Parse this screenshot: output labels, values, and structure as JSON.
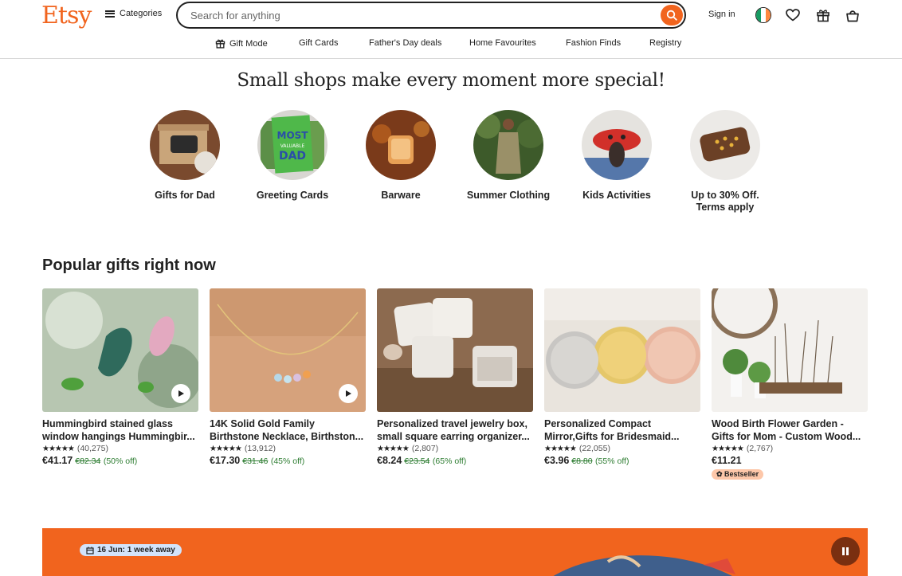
{
  "header": {
    "logo": "Etsy",
    "categories_label": "Categories",
    "search_placeholder": "Search for anything",
    "sign_in": "Sign in"
  },
  "nav": {
    "items": [
      "Gift Mode",
      "Gift Cards",
      "Father's Day deals",
      "Home Favourites",
      "Fashion Finds",
      "Registry"
    ]
  },
  "headline": "Small shops make every moment more special!",
  "circles": [
    {
      "label": "Gifts for Dad"
    },
    {
      "label": "Greeting Cards"
    },
    {
      "label": "Barware"
    },
    {
      "label": "Summer Clothing"
    },
    {
      "label": "Kids Activities"
    },
    {
      "label": "Up to 30% Off. Terms apply"
    }
  ],
  "greeting_card_text": {
    "line1": "MOST",
    "line2": "VALUABLE",
    "line3": "DAD"
  },
  "popular": {
    "title": "Popular gifts right now",
    "items": [
      {
        "title1": "Hummingbird stained glass",
        "title2": "window hangings Hummingbir...",
        "reviews": "(40,275)",
        "price": "€41.17",
        "old_price": "€82.34",
        "discount": "(50% off)"
      },
      {
        "title1": "14K Solid Gold Family",
        "title2": "Birthstone Necklace, Birthston...",
        "reviews": "(13,912)",
        "price": "€17.30",
        "old_price": "€31.46",
        "discount": "(45% off)"
      },
      {
        "title1": "Personalized travel jewelry box,",
        "title2": "small square earring organizer...",
        "reviews": "(2,807)",
        "price": "€8.24",
        "old_price": "€23.54",
        "discount": "(65% off)"
      },
      {
        "title1": "Personalized Compact",
        "title2": "Mirror,Gifts for Bridesmaid...",
        "reviews": "(22,055)",
        "price": "€3.96",
        "old_price": "€8.80",
        "discount": "(55% off)"
      },
      {
        "title1": "Wood Birth Flower Garden -",
        "title2": "Gifts for Mom - Custom Wood...",
        "reviews": "(2,767)",
        "price": "€11.21",
        "badge": "Bestseller"
      }
    ]
  },
  "banner": {
    "date_pill": "16 Jun: 1 week away"
  },
  "colors": {
    "brand": "#f1641e",
    "sale_green": "#2e7d32",
    "badge_bg": "#fdc7a9"
  }
}
